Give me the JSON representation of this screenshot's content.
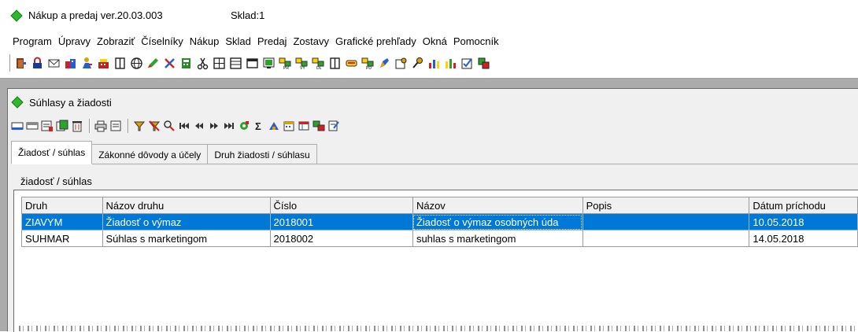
{
  "window": {
    "title": "Nákup a predaj ver.20.03.003",
    "warehouse": "Sklad:1"
  },
  "menu": [
    "Program",
    "Úpravy",
    "Zobraziť",
    "Číselníky",
    "Nákup",
    "Sklad",
    "Predaj",
    "Zostavy",
    "Grafické prehľady",
    "Okná",
    "Pomocník"
  ],
  "colors": {
    "accent": "#0078d7",
    "app_icon": "#2eb82e"
  },
  "child": {
    "title": "Súhlasy a žiadosti",
    "tabs": [
      "Žiadosť / súhlas",
      "Zákonné dôvody a účely",
      "Druh žiadosti / súhlasu"
    ],
    "active_tab": 0,
    "panel_label": "žiadosť / súhlas",
    "grid": {
      "columns": [
        "Druh",
        "Názov druhu",
        "Číslo",
        "Názov",
        "Popis",
        "Dátum príchodu"
      ],
      "rows": [
        [
          "ZIAVYM",
          "Žiadosť o výmaz",
          "2018001",
          "Žiadosť o výmaz osobných úda",
          "",
          "10.05.2018"
        ],
        [
          "SUHMAR",
          "Súhlas s marketingom",
          "2018002",
          "suhlas s marketingom",
          "",
          "14.05.2018"
        ]
      ],
      "selected_row": 0
    }
  }
}
